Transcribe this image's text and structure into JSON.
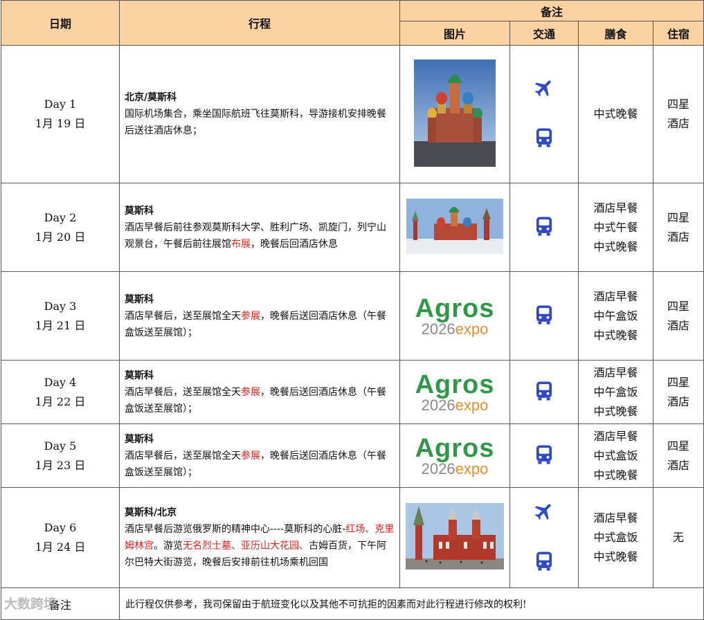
{
  "header": {
    "date": "日期",
    "plan": "行程",
    "remarks": "备注",
    "image": "图片",
    "transport": "交通",
    "meals": "膳食",
    "stay": "住宿"
  },
  "days": [
    {
      "day": "Day 1",
      "date": "1月 19 日",
      "title": "北京/莫斯科",
      "body": [
        {
          "t": "国际机场集合，乘坐国际航班飞往莫斯科，导游接机安排晚餐后送往酒店休息；",
          "hl": false
        }
      ],
      "image": "photo-st-basils-cathedral",
      "transport": [
        "plane-icon",
        "bus-icon"
      ],
      "meals": [
        "中式晚餐"
      ],
      "stay": [
        "四星",
        "酒店"
      ]
    },
    {
      "day": "Day 2",
      "date": "1月 20 日",
      "title": "莫斯科",
      "body": [
        {
          "t": "酒店早餐后前往参观莫斯科大学、胜利广场、凯旋门，列宁山观景台，午餐后前往展馆",
          "hl": false
        },
        {
          "t": "布展",
          "hl": true
        },
        {
          "t": "，晚餐后回酒店休息",
          "hl": false
        }
      ],
      "image": "photo-red-square-winter",
      "transport": [
        "bus-icon"
      ],
      "meals": [
        "酒店早餐",
        "中式午餐",
        "中式晚餐"
      ],
      "stay": [
        "四星",
        "酒店"
      ]
    },
    {
      "day": "Day 3",
      "date": "1月 21 日",
      "title": "莫斯科",
      "body": [
        {
          "t": "酒店早餐后，送至展馆全天",
          "hl": false
        },
        {
          "t": "参展",
          "hl": true
        },
        {
          "t": "，晚餐后送回酒店休息（午餐盒饭送至展馆）；",
          "hl": false
        }
      ],
      "image": "agros-logo",
      "transport": [
        "bus-icon"
      ],
      "meals": [
        "酒店早餐",
        "中午盒饭",
        "中式晚餐"
      ],
      "stay": [
        "四星",
        "酒店"
      ]
    },
    {
      "day": "Day 4",
      "date": "1月 22 日",
      "title": "莫斯科",
      "body": [
        {
          "t": "酒店早餐后，送至展馆全天",
          "hl": false
        },
        {
          "t": "参展",
          "hl": true
        },
        {
          "t": "，晚餐后送回酒店休息（午餐盒饭送至展馆）；",
          "hl": false
        }
      ],
      "image": "agros-logo",
      "transport": [
        "bus-icon"
      ],
      "meals": [
        "酒店早餐",
        "中午盒饭",
        "中式晚餐"
      ],
      "stay": [
        "四星",
        "酒店"
      ]
    },
    {
      "day": "Day 5",
      "date": "1月 23 日",
      "title": "莫斯科",
      "body": [
        {
          "t": "酒店早餐后，送至展馆全天",
          "hl": false
        },
        {
          "t": "参展",
          "hl": true
        },
        {
          "t": "，晚餐后送回酒店休息（午餐盒饭送至展馆）；",
          "hl": false
        }
      ],
      "image": "agros-logo",
      "transport": [
        "bus-icon"
      ],
      "meals": [
        "酒店早餐",
        "中式盒饭",
        "中式晚餐"
      ],
      "stay": [
        "四星",
        "酒店"
      ]
    },
    {
      "day": "Day 6",
      "date": "1月 24 日",
      "title": "莫斯科/北京",
      "body": [
        {
          "t": "酒店早餐后游览俄罗斯的精神中心----莫斯科的心脏-",
          "hl": false
        },
        {
          "t": "红场、克里姆林宫",
          "hl": true
        },
        {
          "t": "。游览",
          "hl": false
        },
        {
          "t": "无名烈士墓、亚历山大花园、",
          "hl": true
        },
        {
          "t": "古姆百货，下午阿尔巴特大街游览，晚餐后安排前往机场乘机回国",
          "hl": false
        }
      ],
      "image": "photo-historical-museum",
      "transport": [
        "plane-icon",
        "bus-icon"
      ],
      "meals": [
        "酒店早餐",
        "中式盒饭",
        "中式晚餐"
      ],
      "stay": [
        "无"
      ]
    }
  ],
  "agros": {
    "big": "Agros",
    "year": "2026",
    "expo": "expo"
  },
  "note": {
    "label": "备注",
    "text": "此行程仅供参考，我司保留由于航班变化以及其他不可抗拒的因素而对此行程进行修改的权利!"
  },
  "watermark": "大数跨境",
  "colors": {
    "header_bg": "#fcd2a3",
    "highlight": "#e0201b",
    "icon_blue": "#2f49c9",
    "agros_green": "#2e9a47",
    "agros_orange": "#e88e2c"
  }
}
